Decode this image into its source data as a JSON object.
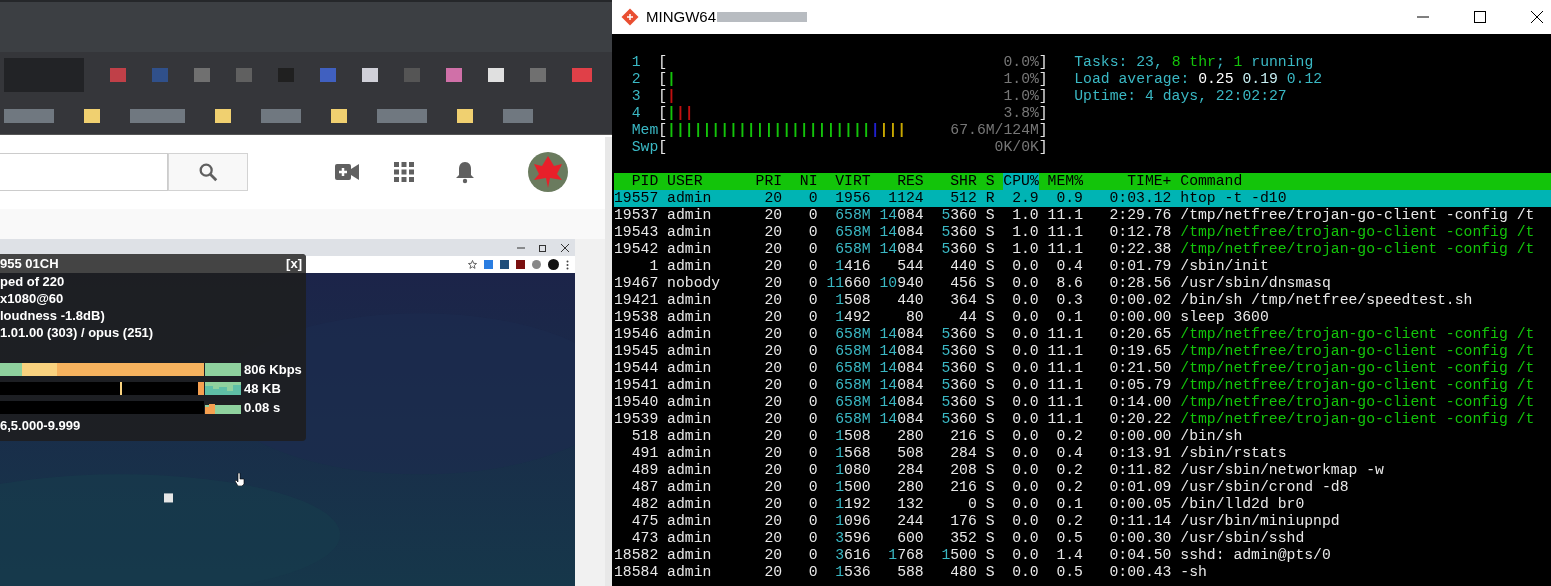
{
  "stats_overlay": {
    "close": "[x]",
    "lines": [
      "955 01CH",
      "ped of 220",
      "x1080@60",
      "loudness -1.8dB)",
      "1.01.00 (303) / opus (251)"
    ],
    "meters": [
      {
        "kind": "bandwidth",
        "reading": "806 Kbps"
      },
      {
        "kind": "buffer",
        "reading": "48 KB"
      },
      {
        "kind": "latency",
        "reading": "0.08 s"
      }
    ],
    "footer": "6,5.000-9.999"
  },
  "terminal": {
    "title": "MINGW64",
    "meters": [
      {
        "label": "1",
        "open": "[",
        "reading": "0.0%",
        "close": "]"
      },
      {
        "label": "2",
        "open": "[",
        "segments": [
          {
            "text": "|",
            "color": "#13c40a"
          }
        ],
        "reading": "1.0%",
        "close": "]"
      },
      {
        "label": "3",
        "open": "[",
        "segments": [
          {
            "text": "|",
            "color": "#c01010"
          }
        ],
        "reading": "1.0%",
        "close": "]"
      },
      {
        "label": "4",
        "open": "[",
        "segments": [
          {
            "text": "|",
            "color": "#13c40a"
          },
          {
            "text": "||",
            "color": "#c01010"
          }
        ],
        "reading": "3.8%",
        "close": "]"
      },
      {
        "label": "Mem",
        "open": "[",
        "segments": [
          {
            "text": "|||||||||||||||||||||||",
            "color": "#13c40a"
          },
          {
            "text": "|",
            "color": "#2020d0"
          },
          {
            "text": "|||",
            "color": "#c8a800"
          }
        ],
        "reading": "67.6M/124M",
        "close": "]"
      },
      {
        "label": "Swp",
        "open": "[",
        "reading": "0K/0K",
        "close": "]"
      }
    ],
    "info": [
      [
        {
          "text": "Tasks: 23, ",
          "color": "#3ab8c4"
        },
        {
          "text": "8 thr",
          "color": "#13c40a"
        },
        {
          "text": "; ",
          "color": "#3ab8c4"
        },
        {
          "text": "1",
          "color": "#13c40a"
        },
        {
          "text": " running",
          "color": "#3ab8c4"
        }
      ],
      [
        {
          "text": "Load average: ",
          "color": "#3ab8c4"
        },
        {
          "text": "0.25 ",
          "color": "#ffffff"
        },
        {
          "text": "0.19 ",
          "color": "#c8f0f4"
        },
        {
          "text": "0.12",
          "color": "#3ab8c4"
        }
      ],
      [
        {
          "text": "Uptime: 4 days, 22:02:27",
          "color": "#3ab8c4"
        }
      ]
    ],
    "columns": [
      {
        "label": "PID",
        "selected": false
      },
      {
        "label": "USER",
        "selected": false
      },
      {
        "label": "PRI",
        "selected": false
      },
      {
        "label": "NI",
        "selected": false
      },
      {
        "label": "VIRT",
        "selected": false
      },
      {
        "label": "RES",
        "selected": false
      },
      {
        "label": "SHR",
        "selected": false
      },
      {
        "label": "S",
        "selected": false
      },
      {
        "label": "CPU%",
        "selected": true
      },
      {
        "label": "MEM%",
        "selected": false
      },
      {
        "label": "TIME+",
        "selected": false
      },
      {
        "label": "Command",
        "selected": false
      }
    ],
    "rows": [
      {
        "pid": "19557",
        "user": "admin",
        "pri": "20",
        "ni": "0",
        "virt": "1956",
        "res": "1124",
        "shr": "512",
        "s": "R",
        "cpu": "2.9",
        "mem": "0.9",
        "time": "0:03.12",
        "command": "htop -t -d10",
        "selected": true,
        "thread": false
      },
      {
        "pid": "19537",
        "user": "admin",
        "pri": "20",
        "ni": "0",
        "virt": "**658M**",
        "res": "**14**084",
        "shr": "**5**360",
        "s": "S",
        "cpu": "1.0",
        "mem": "11.1",
        "time": "2:29.76",
        "command": "/tmp/netfree/trojan-go-client -config /t",
        "selected": false,
        "thread": false
      },
      {
        "pid": "19543",
        "user": "admin",
        "pri": "20",
        "ni": "0",
        "virt": "**658M**",
        "res": "**14**084",
        "shr": "**5**360",
        "s": "S",
        "cpu": "1.0",
        "mem": "11.1",
        "time": "0:12.78",
        "command": "/tmp/netfree/trojan-go-client -config /t",
        "selected": false,
        "thread": true
      },
      {
        "pid": "19542",
        "user": "admin",
        "pri": "20",
        "ni": "0",
        "virt": "**658M**",
        "res": "**14**084",
        "shr": "**5**360",
        "s": "S",
        "cpu": "1.0",
        "mem": "11.1",
        "time": "0:22.38",
        "command": "/tmp/netfree/trojan-go-client -config /t",
        "selected": false,
        "thread": true
      },
      {
        "pid": "1",
        "user": "admin",
        "pri": "20",
        "ni": "0",
        "virt": "**1**416",
        "res": "544",
        "shr": "440",
        "s": "S",
        "cpu": "0.0",
        "mem": "0.4",
        "time": "0:01.79",
        "command": "/sbin/init",
        "selected": false,
        "thread": false
      },
      {
        "pid": "19467",
        "user": "nobody",
        "pri": "20",
        "ni": "0",
        "virt": "**11**660",
        "res": "**10**940",
        "shr": "456",
        "s": "S",
        "cpu": "0.0",
        "mem": "8.6",
        "time": "0:28.56",
        "command": "/usr/sbin/dnsmasq",
        "selected": false,
        "thread": false
      },
      {
        "pid": "19421",
        "user": "admin",
        "pri": "20",
        "ni": "0",
        "virt": "**1**508",
        "res": "440",
        "shr": "364",
        "s": "S",
        "cpu": "0.0",
        "mem": "0.3",
        "time": "0:00.02",
        "command": "/bin/sh /tmp/netfree/speedtest.sh",
        "selected": false,
        "thread": false
      },
      {
        "pid": "19538",
        "user": "admin",
        "pri": "20",
        "ni": "0",
        "virt": "**1**492",
        "res": "80",
        "shr": "44",
        "s": "S",
        "cpu": "0.0",
        "mem": "0.1",
        "time": "0:00.00",
        "command": "sleep 3600",
        "selected": false,
        "thread": false
      },
      {
        "pid": "19546",
        "user": "admin",
        "pri": "20",
        "ni": "0",
        "virt": "**658M**",
        "res": "**14**084",
        "shr": "**5**360",
        "s": "S",
        "cpu": "0.0",
        "mem": "11.1",
        "time": "0:20.65",
        "command": "/tmp/netfree/trojan-go-client -config /t",
        "selected": false,
        "thread": true
      },
      {
        "pid": "19545",
        "user": "admin",
        "pri": "20",
        "ni": "0",
        "virt": "**658M**",
        "res": "**14**084",
        "shr": "**5**360",
        "s": "S",
        "cpu": "0.0",
        "mem": "11.1",
        "time": "0:19.65",
        "command": "/tmp/netfree/trojan-go-client -config /t",
        "selected": false,
        "thread": true
      },
      {
        "pid": "19544",
        "user": "admin",
        "pri": "20",
        "ni": "0",
        "virt": "**658M**",
        "res": "**14**084",
        "shr": "**5**360",
        "s": "S",
        "cpu": "0.0",
        "mem": "11.1",
        "time": "0:21.50",
        "command": "/tmp/netfree/trojan-go-client -config /t",
        "selected": false,
        "thread": true
      },
      {
        "pid": "19541",
        "user": "admin",
        "pri": "20",
        "ni": "0",
        "virt": "**658M**",
        "res": "**14**084",
        "shr": "**5**360",
        "s": "S",
        "cpu": "0.0",
        "mem": "11.1",
        "time": "0:05.79",
        "command": "/tmp/netfree/trojan-go-client -config /t",
        "selected": false,
        "thread": true
      },
      {
        "pid": "19540",
        "user": "admin",
        "pri": "20",
        "ni": "0",
        "virt": "**658M**",
        "res": "**14**084",
        "shr": "**5**360",
        "s": "S",
        "cpu": "0.0",
        "mem": "11.1",
        "time": "0:14.00",
        "command": "/tmp/netfree/trojan-go-client -config /t",
        "selected": false,
        "thread": true
      },
      {
        "pid": "19539",
        "user": "admin",
        "pri": "20",
        "ni": "0",
        "virt": "**658M**",
        "res": "**14**084",
        "shr": "**5**360",
        "s": "S",
        "cpu": "0.0",
        "mem": "11.1",
        "time": "0:20.22",
        "command": "/tmp/netfree/trojan-go-client -config /t",
        "selected": false,
        "thread": true
      },
      {
        "pid": "518",
        "user": "admin",
        "pri": "20",
        "ni": "0",
        "virt": "**1**508",
        "res": "280",
        "shr": "216",
        "s": "S",
        "cpu": "0.0",
        "mem": "0.2",
        "time": "0:00.00",
        "command": "/bin/sh",
        "selected": false,
        "thread": false
      },
      {
        "pid": "491",
        "user": "admin",
        "pri": "20",
        "ni": "0",
        "virt": "**1**568",
        "res": "508",
        "shr": "284",
        "s": "S",
        "cpu": "0.0",
        "mem": "0.4",
        "time": "0:13.91",
        "command": "/sbin/rstats",
        "selected": false,
        "thread": false
      },
      {
        "pid": "489",
        "user": "admin",
        "pri": "20",
        "ni": "0",
        "virt": "**1**080",
        "res": "284",
        "shr": "208",
        "s": "S",
        "cpu": "0.0",
        "mem": "0.2",
        "time": "0:11.82",
        "command": "/usr/sbin/networkmap -w",
        "selected": false,
        "thread": false
      },
      {
        "pid": "487",
        "user": "admin",
        "pri": "20",
        "ni": "0",
        "virt": "**1**500",
        "res": "280",
        "shr": "216",
        "s": "S",
        "cpu": "0.0",
        "mem": "0.2",
        "time": "0:01.09",
        "command": "/usr/sbin/crond -d8",
        "selected": false,
        "thread": false
      },
      {
        "pid": "482",
        "user": "admin",
        "pri": "20",
        "ni": "0",
        "virt": "**1**192",
        "res": "132",
        "shr": "0",
        "s": "S",
        "cpu": "0.0",
        "mem": "0.1",
        "time": "0:00.05",
        "command": "/bin/lld2d br0",
        "selected": false,
        "thread": false
      },
      {
        "pid": "475",
        "user": "admin",
        "pri": "20",
        "ni": "0",
        "virt": "**1**096",
        "res": "244",
        "shr": "176",
        "s": "S",
        "cpu": "0.0",
        "mem": "0.2",
        "time": "0:11.14",
        "command": "/usr/bin/miniupnpd",
        "selected": false,
        "thread": false
      },
      {
        "pid": "473",
        "user": "admin",
        "pri": "20",
        "ni": "0",
        "virt": "**3**596",
        "res": "600",
        "shr": "352",
        "s": "S",
        "cpu": "0.0",
        "mem": "0.5",
        "time": "0:00.30",
        "command": "/usr/sbin/sshd",
        "selected": false,
        "thread": false
      },
      {
        "pid": "18582",
        "user": "admin",
        "pri": "20",
        "ni": "0",
        "virt": "**3**616",
        "res": "**1**768",
        "shr": "**1**500",
        "s": "S",
        "cpu": "0.0",
        "mem": "1.4",
        "time": "0:04.50",
        "command": "sshd: admin@pts/0",
        "selected": false,
        "thread": false
      },
      {
        "pid": "18584",
        "user": "admin",
        "pri": "20",
        "ni": "0",
        "virt": "**1**536",
        "res": "588",
        "shr": "480",
        "s": "S",
        "cpu": "0.0",
        "mem": "0.5",
        "time": "0:00.43",
        "command": "-sh",
        "selected": false,
        "thread": false
      }
    ]
  }
}
